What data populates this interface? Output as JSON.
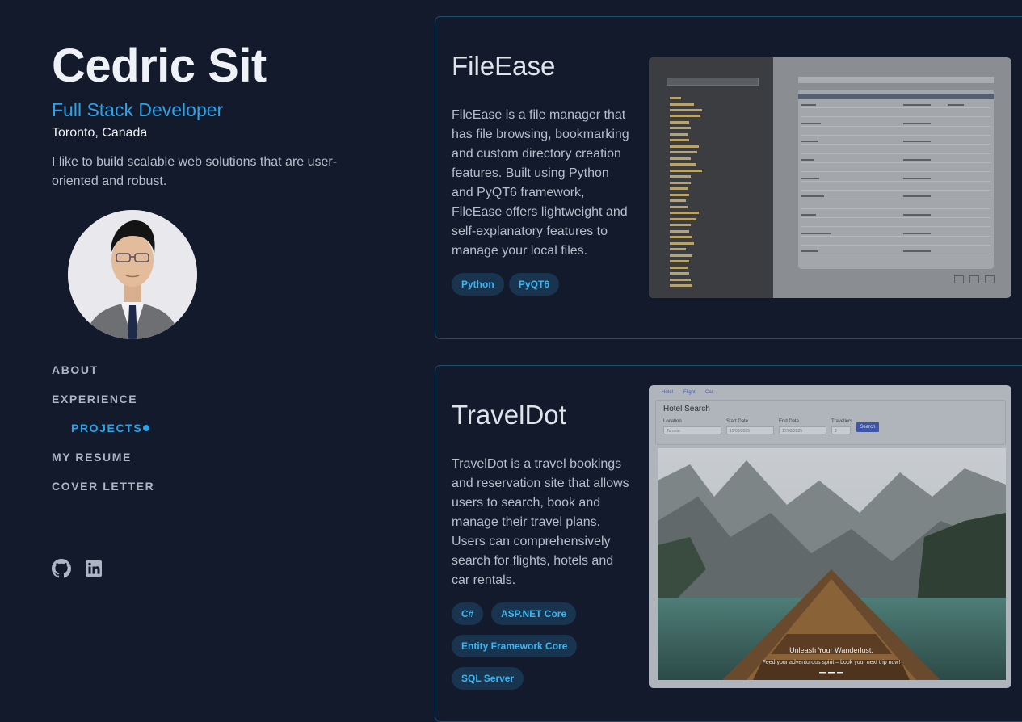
{
  "profile": {
    "name": "Cedric Sit",
    "role": "Full Stack Developer",
    "location": "Toronto, Canada",
    "bio": "I like to build scalable web solutions that are user-oriented and robust."
  },
  "nav": {
    "about": "ABOUT",
    "experience": "EXPERIENCE",
    "projects": "PROJECTS",
    "resume": "MY RESUME",
    "cover_letter": "COVER LETTER"
  },
  "socials": [
    "github-icon",
    "linkedin-icon"
  ],
  "colors": {
    "background": "#121a2b",
    "accent": "#2ba3e8",
    "card_border": "#1d4e73",
    "tag_bg": "#18344f"
  },
  "projects": [
    {
      "title": "FileEase",
      "description": "FileEase is a file manager that has file browsing, bookmarking and custom directory creation features. Built using Python and PyQT6 framework, FileEase offers lightweight and self-explanatory features to manage your local files.",
      "tags": [
        "Python",
        "PyQT6"
      ]
    },
    {
      "title": "TravelDot",
      "description": "TravelDot is a travel bookings and reservation site that allows users to search, book and manage their travel plans. Users can comprehensively search for flights, hotels and car rentals.",
      "tags": [
        "C#",
        "ASP.NET Core",
        "Entity Framework Core",
        "SQL Server"
      ],
      "screenshot": {
        "tabs": [
          "Hotel",
          "Flight",
          "Car"
        ],
        "heading": "Hotel Search",
        "fields": {
          "location_label": "Location",
          "location_placeholder": "Toronto",
          "start_label": "Start Date",
          "start_value": "15/03/2025",
          "end_label": "End Date",
          "end_value": "17/03/2025",
          "travellers_label": "Travellers",
          "travellers_value": "2"
        },
        "search_label": "Search",
        "hero_title": "Unleash Your Wanderlust.",
        "hero_subtitle": "Feed your adventurous spirit – book your next trip now!"
      }
    }
  ]
}
